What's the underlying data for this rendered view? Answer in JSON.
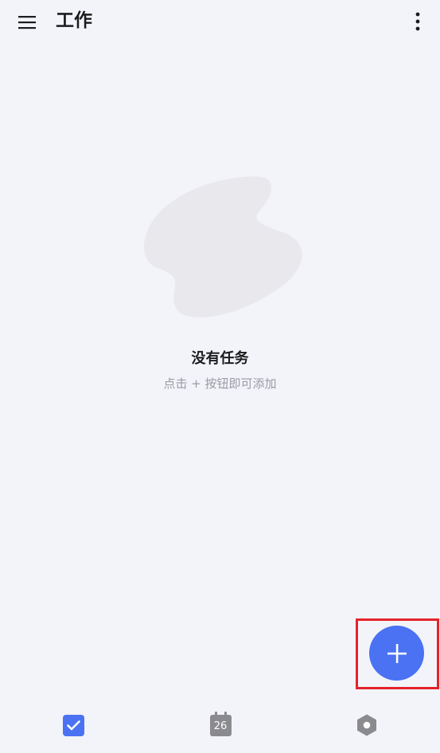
{
  "header": {
    "title": "工作",
    "menu_icon": "hamburger-menu-icon",
    "more_icon": "more-vertical-icon"
  },
  "empty_state": {
    "title": "没有任务",
    "subtitle": "点击 + 按钮即可添加",
    "illustration": "blob-illustration"
  },
  "fab": {
    "icon": "plus-icon",
    "color": "#4a72f2",
    "highlight_color": "#e5222b"
  },
  "bottom_nav": {
    "items": [
      {
        "name": "tasks",
        "icon": "check-square-icon",
        "active": true
      },
      {
        "name": "calendar",
        "icon": "calendar-icon",
        "day": "26",
        "active": false
      },
      {
        "name": "settings",
        "icon": "hexagon-settings-icon",
        "active": false
      }
    ]
  },
  "colors": {
    "background": "#f3f4f9",
    "accent": "#4a72f2",
    "inactive_icon": "#8a8a8f"
  }
}
